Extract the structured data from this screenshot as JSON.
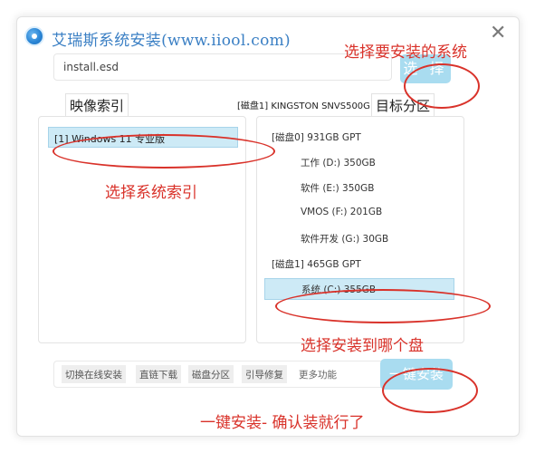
{
  "window": {
    "title": "艾瑞斯系统安装(www.iiool.com)",
    "close_glyph": "✕"
  },
  "source": {
    "path_value": "install.esd",
    "select_label": "选 择"
  },
  "image_index": {
    "tab_label": "映像索引",
    "items": [
      {
        "label": "[1] Windows 11 专业版",
        "selected": true
      }
    ]
  },
  "target": {
    "disk_label": "[磁盘1] KINGSTON SNVS500G",
    "tab_label": "目标分区",
    "partitions": [
      {
        "label": "[磁盘0]  931GB  GPT",
        "kind": "disk",
        "selected": false
      },
      {
        "label": "工作 (D:) 350GB",
        "kind": "partition",
        "selected": false
      },
      {
        "label": "软件 (E:) 350GB",
        "kind": "partition",
        "selected": false
      },
      {
        "label": "VMOS (F:) 201GB",
        "kind": "partition",
        "selected": false
      },
      {
        "label": "软件开发 (G:) 30GB",
        "kind": "partition",
        "selected": false
      },
      {
        "label": "[磁盘1]  465GB  GPT",
        "kind": "disk",
        "selected": false
      },
      {
        "label": "系统 (C:) 355GB",
        "kind": "partition",
        "selected": true
      }
    ]
  },
  "toolbar": {
    "buttons": [
      "切换在线安装",
      "直链下载",
      "磁盘分区",
      "引导修复"
    ],
    "more_label": "更多功能",
    "install_label": "一键安装"
  },
  "annotations": {
    "select_system": "选择要安装的系统",
    "select_index": "选择系统索引",
    "select_disk": "选择安装到哪个盘",
    "one_click": "一键安装- 确认装就行了",
    "color": "#d9322a"
  },
  "colors": {
    "title": "#3a7fc4",
    "button": "#a9dcf0",
    "selection": "#cdeaf6"
  }
}
